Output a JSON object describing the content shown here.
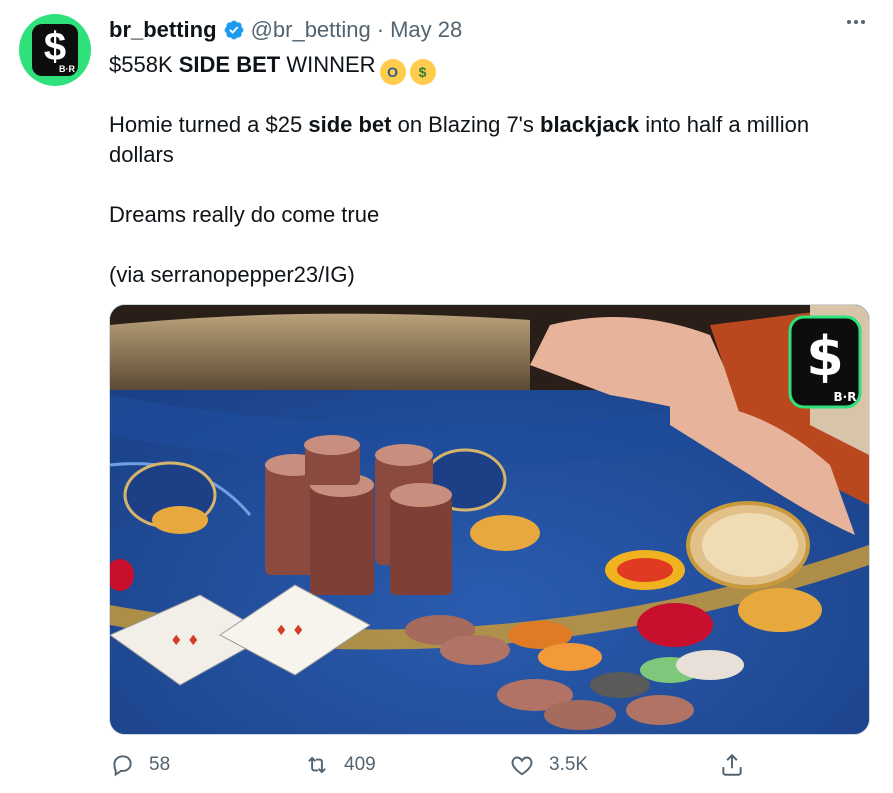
{
  "tweet": {
    "author_name": "br_betting",
    "handle": "@br_betting",
    "separator": "·",
    "date": "May 28",
    "headline_prefix": "$558K ",
    "headline_bold": "SIDE BET",
    "headline_suffix": " WINNER",
    "line1_a": "Homie turned a $25 ",
    "line1_b": "side bet",
    "line1_c": " on Blazing 7's ",
    "line1_d": "blackjack",
    "line1_e": " into half a million dollars",
    "line2": "Dreams really do come true",
    "line3": "(via serranopepper23/IG)"
  },
  "avatar": {
    "symbol": "$",
    "sub": "B·R",
    "color": "#2fe17a"
  },
  "media": {
    "watermark_symbol": "$",
    "watermark_sub": "B·R"
  },
  "actions": {
    "reply_count": "58",
    "retweet_count": "409",
    "like_count": "3.5K"
  },
  "icons": {
    "verified": "verified-badge-icon",
    "more": "more-options-icon",
    "reply": "reply-icon",
    "retweet": "retweet-icon",
    "like": "heart-icon",
    "share": "share-icon"
  },
  "colors": {
    "accent": "#1d9bf0",
    "text": "#0f1419",
    "muted": "#536471",
    "brand_green": "#2fe17a"
  }
}
